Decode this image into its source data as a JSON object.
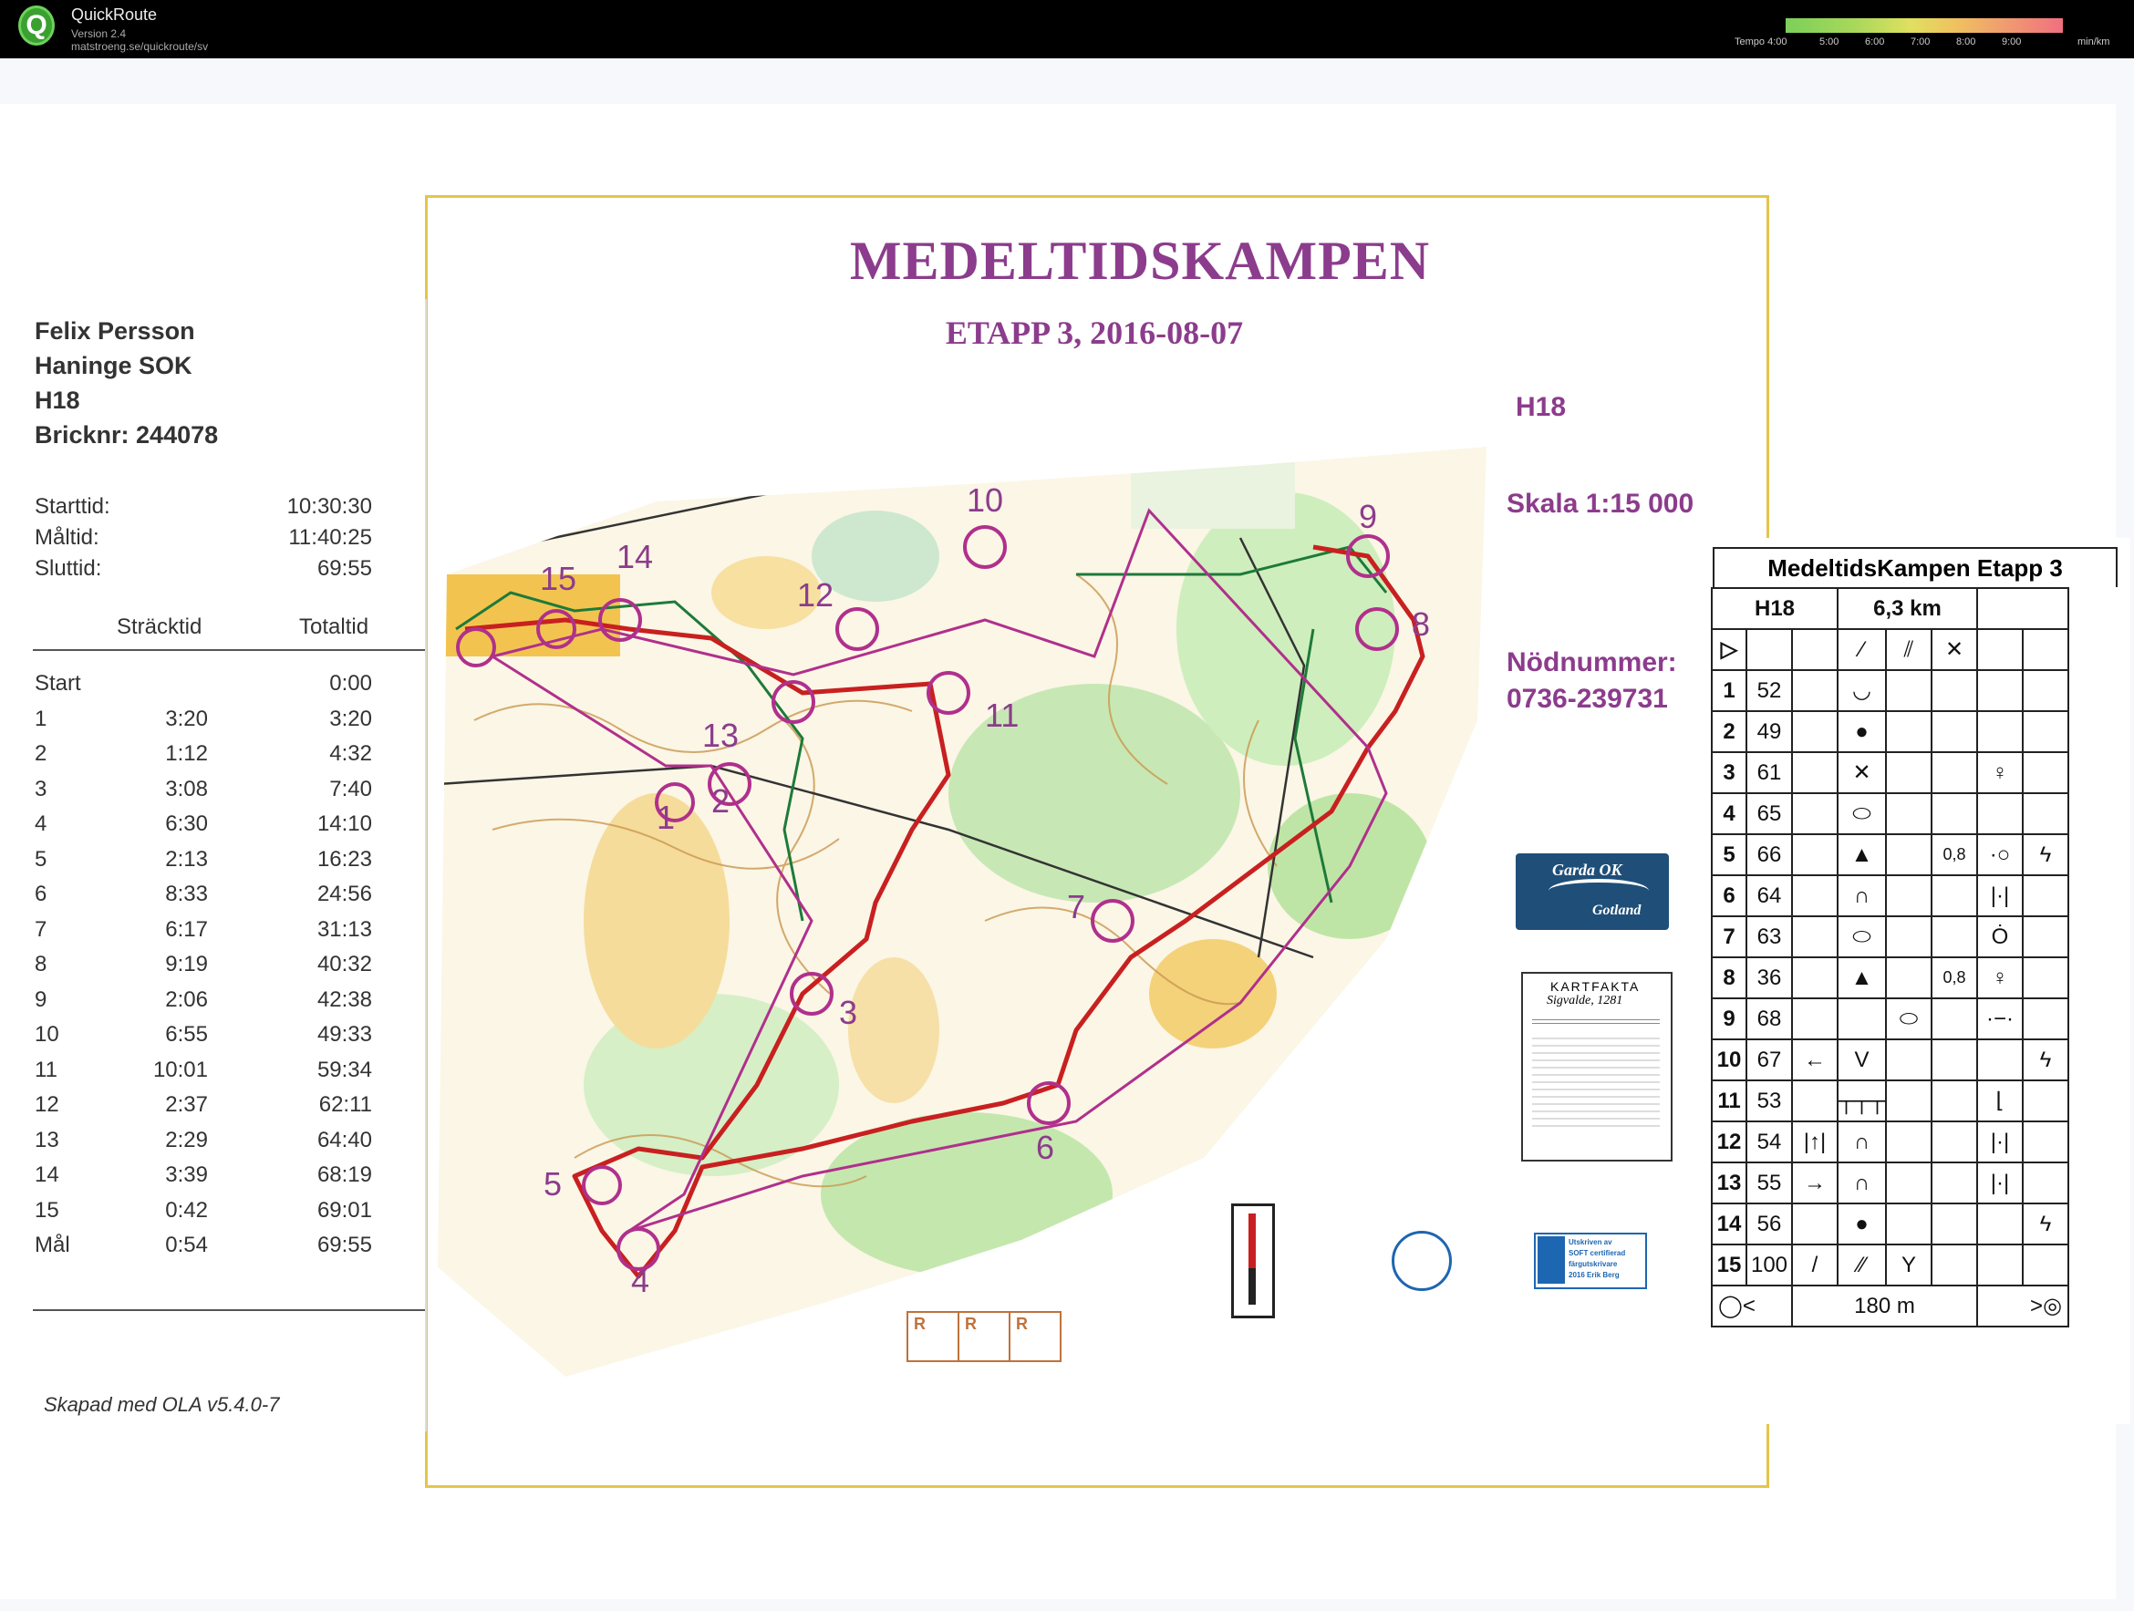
{
  "app": {
    "name": "QuickRoute",
    "version": "Version 2.4",
    "url": "matstroeng.se/quickroute/sv",
    "legend_labels": [
      "Tempo 4:00",
      "5:00",
      "6:00",
      "7:00",
      "8:00",
      "9:00",
      "min/km"
    ]
  },
  "map": {
    "title": "MEDELTIDSKAMPEN",
    "subtitle": "ETAPP 3, 2016-08-07",
    "class": "H18",
    "scale": "Skala 1:15 000",
    "emergency_label": "Nödnummer:",
    "emergency_number": "0736-239731",
    "controls": [
      "1",
      "2",
      "3",
      "4",
      "5",
      "6",
      "7",
      "8",
      "9",
      "10",
      "11",
      "12",
      "13",
      "14",
      "15"
    ],
    "colors": {
      "course": "#b0308c",
      "route": "#c82020",
      "forest": "#9fd88a",
      "open": "#f2c44f",
      "contour": "#c08a3c"
    },
    "club_logo_text_1": "Garda OK",
    "club_logo_text_2": "Gotland",
    "kartfakta_title": "KARTFAKTA",
    "kartfakta_sub": "Sigvalde, 1281",
    "sofi_text_1": "Utskriven av",
    "sofi_text_2": "SOFT certifierad",
    "sofi_text_3": "färgutskrivare",
    "sofi_text_4": "2016 Erik Berg",
    "r_boxes": [
      "R",
      "R",
      "R"
    ]
  },
  "slip": {
    "name": "Felix Persson",
    "club": "Haninge SOK",
    "class": "H18",
    "chip": "Bricknr: 244078",
    "start_label": "Starttid:",
    "start_value": "10:30:30",
    "finish_label": "Måltid:",
    "finish_value": "11:40:25",
    "total_label": "Sluttid:",
    "total_value": "69:55",
    "col_split": "Sträcktid",
    "col_total": "Totaltid",
    "rows": [
      {
        "ctrl": "Start",
        "split": "",
        "total": "0:00"
      },
      {
        "ctrl": "1",
        "split": "3:20",
        "total": "3:20"
      },
      {
        "ctrl": "2",
        "split": "1:12",
        "total": "4:32"
      },
      {
        "ctrl": "3",
        "split": "3:08",
        "total": "7:40"
      },
      {
        "ctrl": "4",
        "split": "6:30",
        "total": "14:10"
      },
      {
        "ctrl": "5",
        "split": "2:13",
        "total": "16:23"
      },
      {
        "ctrl": "6",
        "split": "8:33",
        "total": "24:56"
      },
      {
        "ctrl": "7",
        "split": "6:17",
        "total": "31:13"
      },
      {
        "ctrl": "8",
        "split": "9:19",
        "total": "40:32"
      },
      {
        "ctrl": "9",
        "split": "2:06",
        "total": "42:38"
      },
      {
        "ctrl": "10",
        "split": "6:55",
        "total": "49:33"
      },
      {
        "ctrl": "11",
        "split": "10:01",
        "total": "59:34"
      },
      {
        "ctrl": "12",
        "split": "2:37",
        "total": "62:11"
      },
      {
        "ctrl": "13",
        "split": "2:29",
        "total": "64:40"
      },
      {
        "ctrl": "14",
        "split": "3:39",
        "total": "68:19"
      },
      {
        "ctrl": "15",
        "split": "0:42",
        "total": "69:01"
      },
      {
        "ctrl": "Mål",
        "split": "0:54",
        "total": "69:55"
      }
    ],
    "footer": "Skapad med OLA v5.4.0-7"
  },
  "description": {
    "title": "MedeltidsKampen Etapp 3",
    "class": "H18",
    "length": "6,3 km",
    "finish_distance": "180 m",
    "rows": [
      {
        "n": "1",
        "code": "52",
        "c": "",
        "d": "◡",
        "e": "",
        "f": "",
        "g": "",
        "h": ""
      },
      {
        "n": "2",
        "code": "49",
        "c": "",
        "d": "●",
        "e": "",
        "f": "",
        "g": "",
        "h": ""
      },
      {
        "n": "3",
        "code": "61",
        "c": "",
        "d": "✕",
        "e": "",
        "f": "",
        "g": "♀",
        "h": ""
      },
      {
        "n": "4",
        "code": "65",
        "c": "",
        "d": "⬭",
        "e": "",
        "f": "",
        "g": "",
        "h": ""
      },
      {
        "n": "5",
        "code": "66",
        "c": "",
        "d": "▲",
        "e": "",
        "f": "0,8",
        "g": "·○",
        "h": "ϟ"
      },
      {
        "n": "6",
        "code": "64",
        "c": "",
        "d": "∩",
        "e": "",
        "f": "",
        "g": "|·|",
        "h": ""
      },
      {
        "n": "7",
        "code": "63",
        "c": "",
        "d": "⬭",
        "e": "",
        "f": "",
        "g": "Ȯ",
        "h": ""
      },
      {
        "n": "8",
        "code": "36",
        "c": "",
        "d": "▲",
        "e": "",
        "f": "0,8",
        "g": "♀",
        "h": ""
      },
      {
        "n": "9",
        "code": "68",
        "c": "",
        "d": "",
        "e": "⬭",
        "f": "",
        "g": "·−·",
        "h": ""
      },
      {
        "n": "10",
        "code": "67",
        "c": "←",
        "d": "V",
        "e": "",
        "f": "",
        "g": "",
        "h": "ϟ"
      },
      {
        "n": "11",
        "code": "53",
        "c": "",
        "d": "┬┬┬",
        "e": "",
        "f": "",
        "g": "⌊",
        "h": ""
      },
      {
        "n": "12",
        "code": "54",
        "c": "|↑|",
        "d": "∩",
        "e": "",
        "f": "",
        "g": "|·|",
        "h": ""
      },
      {
        "n": "13",
        "code": "55",
        "c": "→",
        "d": "∩",
        "e": "",
        "f": "",
        "g": "|·|",
        "h": ""
      },
      {
        "n": "14",
        "code": "56",
        "c": "",
        "d": "●",
        "e": "",
        "f": "",
        "g": "",
        "h": "ϟ"
      },
      {
        "n": "15",
        "code": "100",
        "c": "/",
        "d": "⁄⁄",
        "e": "Y",
        "f": "",
        "g": "",
        "h": ""
      }
    ]
  }
}
